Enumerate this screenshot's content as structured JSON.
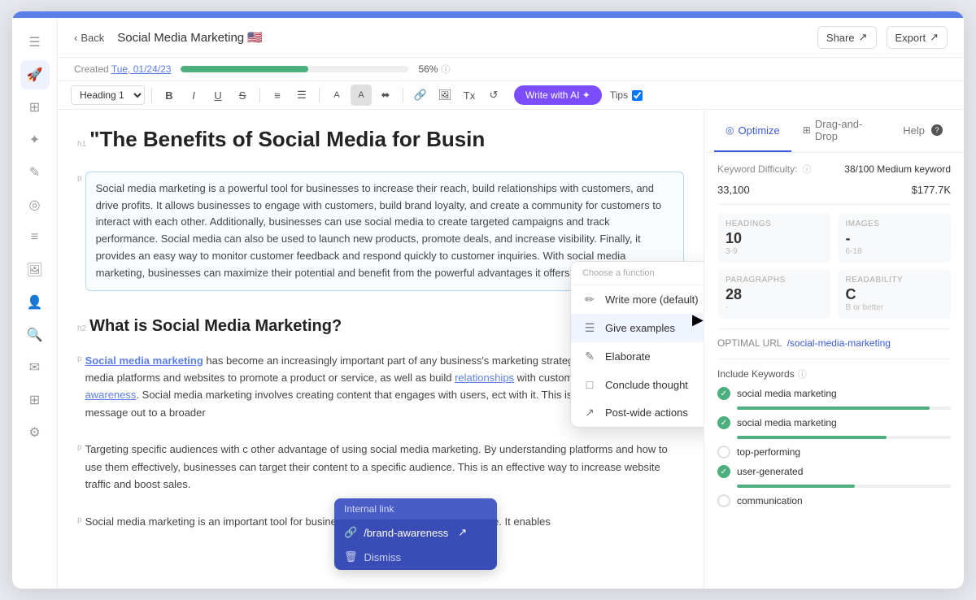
{
  "topBar": {
    "color": "#5b7fe8"
  },
  "sidebar": {
    "icons": [
      {
        "name": "menu-icon",
        "symbol": "☰"
      },
      {
        "name": "rocket-icon",
        "symbol": "🚀"
      },
      {
        "name": "dashboard-icon",
        "symbol": "⊞"
      },
      {
        "name": "magic-icon",
        "symbol": "✦"
      },
      {
        "name": "edit-icon",
        "symbol": "✎"
      },
      {
        "name": "location-icon",
        "symbol": "◎"
      },
      {
        "name": "list-icon",
        "symbol": "≡"
      },
      {
        "name": "image-icon",
        "symbol": "⬜"
      },
      {
        "name": "person-icon",
        "symbol": "👤"
      },
      {
        "name": "search-icon",
        "symbol": "🔍"
      },
      {
        "name": "mail-icon",
        "symbol": "✉"
      },
      {
        "name": "grid-icon",
        "symbol": "⊞"
      },
      {
        "name": "settings-icon",
        "symbol": "⚙"
      }
    ]
  },
  "header": {
    "back_label": "Back",
    "title": "Social Media Marketing",
    "flag": "🇺🇸",
    "share_label": "Share",
    "export_label": "Export"
  },
  "progress": {
    "created_label": "Created",
    "date": "Tue, 01/24/23",
    "percent": 56,
    "percent_label": "56%",
    "bar_width": "56%"
  },
  "toolbar": {
    "heading_select": "Heading 1",
    "write_ai_label": "Write with AI ✦",
    "tips_label": "Tips"
  },
  "ai_dropdown": {
    "header": "Choose a function",
    "items": [
      {
        "id": "write-more",
        "icon": "✏️",
        "label": "Write more (default)"
      },
      {
        "id": "give-examples",
        "icon": "≡",
        "label": "Give examples",
        "selected": true
      },
      {
        "id": "elaborate",
        "icon": "✏",
        "label": "Elaborate"
      },
      {
        "id": "conclude",
        "icon": "□",
        "label": "Conclude thought"
      },
      {
        "id": "post-wide",
        "icon": "↗",
        "label": "Post-wide actions"
      }
    ]
  },
  "internal_link": {
    "header": "Internal link",
    "url": "/brand-awareness",
    "dismiss_label": "Dismiss"
  },
  "editor": {
    "h1": "\"The Benefits of Social Media for Busin",
    "p1": "Social media marketing is a powerful tool for businesses to increase their reach, build relationships with customers, and drive profits. It allows businesses to engage with customers, build brand loyalty, and create a community for customers to interact with each other. Additionally, businesses can use social media to create targeted campaigns and track performance. Social media can also be used to launch new products, promote deals, and increase visibility. Finally, it provides an easy way to monitor customer feedback and respond quickly to customer inquiries. With social media marketing, businesses can maximize their potential and benefit from the powerful advantages it offers.",
    "h2": "What is Social Media Marketing?",
    "p2_1": "Social media marketing",
    "p2_2": " has become an increasingly important part of any business's marketing strategy. It is the use of social media platforms and websites to promote a product or service, as well as build ",
    "p2_link": "relationships",
    "p2_3": " with customers and increase ",
    "p2_link2": "brand awareness",
    "p2_4": ". Social media marketing involves creating content that engages with users, e",
    "p2_5": "ct with it. This is a great way to get your message out to a broader",
    "p3_1": "Targeting specific audiences with c",
    "p3_2": " other advantage of using social media marketing. By understanding",
    "p3_3": " platforms and how to use them effectively, businesses can target their content to a specific audience. This is an effective way to increase website traffic and boost sales.",
    "p4": "Social media marketing is an important tool for businesses to reach their target audience. It enables"
  },
  "right_panel": {
    "tabs": [
      {
        "id": "optimize",
        "label": "Optimize",
        "icon": "◎",
        "active": true
      },
      {
        "id": "drag-drop",
        "label": "Drag-and-Drop",
        "icon": "⊞",
        "active": false
      },
      {
        "id": "help",
        "label": "Help",
        "icon": "?",
        "active": false
      }
    ],
    "kw_difficulty_label": "Keyword Difficulty:",
    "kw_difficulty_value": "38/100 Medium keyword",
    "stat1": "33,100",
    "stat2": "$177.7K",
    "stats": {
      "headings_label": "HEADINGS",
      "headings_value": "10",
      "headings_range": "3-9",
      "images_label": "IMAGES",
      "images_value": "-",
      "images_range": "6-18",
      "paragraphs_label": "PARAGRAPHS",
      "paragraphs_value": "28",
      "paragraphs_sub": "-",
      "readability_label": "READABILITY",
      "readability_value": "C",
      "readability_sub": "B or better"
    },
    "optimal_url_label": "OPTIMAL URL",
    "optimal_url_value": "/social-media-marketing",
    "include_kw_label": "Include Keywords",
    "keywords": [
      {
        "id": "kw1",
        "text": "social media marketing",
        "checked": true,
        "bar_width": "90%"
      },
      {
        "id": "kw2",
        "text": "social media marketing",
        "checked": true,
        "bar_width": "70%"
      },
      {
        "id": "kw3",
        "text": "top-performing",
        "checked": false,
        "bar_width": "0%"
      },
      {
        "id": "kw4",
        "text": "user-generated",
        "checked": true,
        "bar_width": "55%"
      },
      {
        "id": "kw5",
        "text": "communication",
        "checked": false,
        "bar_width": "0%"
      }
    ]
  }
}
